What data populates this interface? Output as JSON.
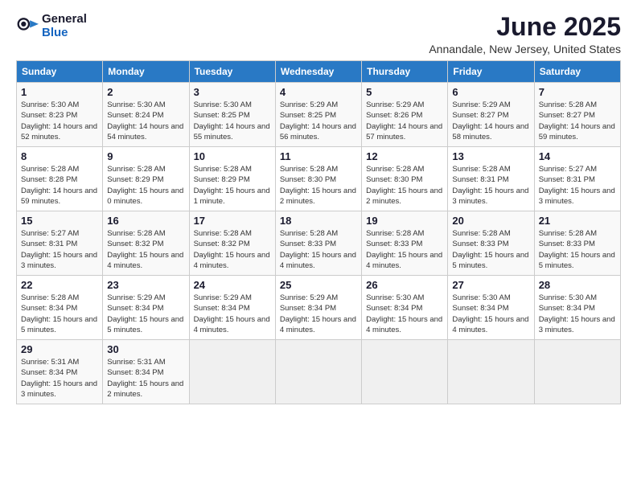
{
  "header": {
    "logo": {
      "general": "General",
      "blue": "Blue"
    },
    "title": "June 2025",
    "location": "Annandale, New Jersey, United States"
  },
  "days_of_week": [
    "Sunday",
    "Monday",
    "Tuesday",
    "Wednesday",
    "Thursday",
    "Friday",
    "Saturday"
  ],
  "weeks": [
    [
      {
        "day": "1",
        "sunrise": "5:30 AM",
        "sunset": "8:23 PM",
        "daylight": "14 hours and 52 minutes."
      },
      {
        "day": "2",
        "sunrise": "5:30 AM",
        "sunset": "8:24 PM",
        "daylight": "14 hours and 54 minutes."
      },
      {
        "day": "3",
        "sunrise": "5:30 AM",
        "sunset": "8:25 PM",
        "daylight": "14 hours and 55 minutes."
      },
      {
        "day": "4",
        "sunrise": "5:29 AM",
        "sunset": "8:25 PM",
        "daylight": "14 hours and 56 minutes."
      },
      {
        "day": "5",
        "sunrise": "5:29 AM",
        "sunset": "8:26 PM",
        "daylight": "14 hours and 57 minutes."
      },
      {
        "day": "6",
        "sunrise": "5:29 AM",
        "sunset": "8:27 PM",
        "daylight": "14 hours and 58 minutes."
      },
      {
        "day": "7",
        "sunrise": "5:28 AM",
        "sunset": "8:27 PM",
        "daylight": "14 hours and 59 minutes."
      }
    ],
    [
      {
        "day": "8",
        "sunrise": "5:28 AM",
        "sunset": "8:28 PM",
        "daylight": "14 hours and 59 minutes."
      },
      {
        "day": "9",
        "sunrise": "5:28 AM",
        "sunset": "8:29 PM",
        "daylight": "15 hours and 0 minutes."
      },
      {
        "day": "10",
        "sunrise": "5:28 AM",
        "sunset": "8:29 PM",
        "daylight": "15 hours and 1 minute."
      },
      {
        "day": "11",
        "sunrise": "5:28 AM",
        "sunset": "8:30 PM",
        "daylight": "15 hours and 2 minutes."
      },
      {
        "day": "12",
        "sunrise": "5:28 AM",
        "sunset": "8:30 PM",
        "daylight": "15 hours and 2 minutes."
      },
      {
        "day": "13",
        "sunrise": "5:28 AM",
        "sunset": "8:31 PM",
        "daylight": "15 hours and 3 minutes."
      },
      {
        "day": "14",
        "sunrise": "5:27 AM",
        "sunset": "8:31 PM",
        "daylight": "15 hours and 3 minutes."
      }
    ],
    [
      {
        "day": "15",
        "sunrise": "5:27 AM",
        "sunset": "8:31 PM",
        "daylight": "15 hours and 3 minutes."
      },
      {
        "day": "16",
        "sunrise": "5:28 AM",
        "sunset": "8:32 PM",
        "daylight": "15 hours and 4 minutes."
      },
      {
        "day": "17",
        "sunrise": "5:28 AM",
        "sunset": "8:32 PM",
        "daylight": "15 hours and 4 minutes."
      },
      {
        "day": "18",
        "sunrise": "5:28 AM",
        "sunset": "8:33 PM",
        "daylight": "15 hours and 4 minutes."
      },
      {
        "day": "19",
        "sunrise": "5:28 AM",
        "sunset": "8:33 PM",
        "daylight": "15 hours and 4 minutes."
      },
      {
        "day": "20",
        "sunrise": "5:28 AM",
        "sunset": "8:33 PM",
        "daylight": "15 hours and 5 minutes."
      },
      {
        "day": "21",
        "sunrise": "5:28 AM",
        "sunset": "8:33 PM",
        "daylight": "15 hours and 5 minutes."
      }
    ],
    [
      {
        "day": "22",
        "sunrise": "5:28 AM",
        "sunset": "8:34 PM",
        "daylight": "15 hours and 5 minutes."
      },
      {
        "day": "23",
        "sunrise": "5:29 AM",
        "sunset": "8:34 PM",
        "daylight": "15 hours and 5 minutes."
      },
      {
        "day": "24",
        "sunrise": "5:29 AM",
        "sunset": "8:34 PM",
        "daylight": "15 hours and 4 minutes."
      },
      {
        "day": "25",
        "sunrise": "5:29 AM",
        "sunset": "8:34 PM",
        "daylight": "15 hours and 4 minutes."
      },
      {
        "day": "26",
        "sunrise": "5:30 AM",
        "sunset": "8:34 PM",
        "daylight": "15 hours and 4 minutes."
      },
      {
        "day": "27",
        "sunrise": "5:30 AM",
        "sunset": "8:34 PM",
        "daylight": "15 hours and 4 minutes."
      },
      {
        "day": "28",
        "sunrise": "5:30 AM",
        "sunset": "8:34 PM",
        "daylight": "15 hours and 3 minutes."
      }
    ],
    [
      {
        "day": "29",
        "sunrise": "5:31 AM",
        "sunset": "8:34 PM",
        "daylight": "15 hours and 3 minutes."
      },
      {
        "day": "30",
        "sunrise": "5:31 AM",
        "sunset": "8:34 PM",
        "daylight": "15 hours and 2 minutes."
      },
      null,
      null,
      null,
      null,
      null
    ]
  ]
}
